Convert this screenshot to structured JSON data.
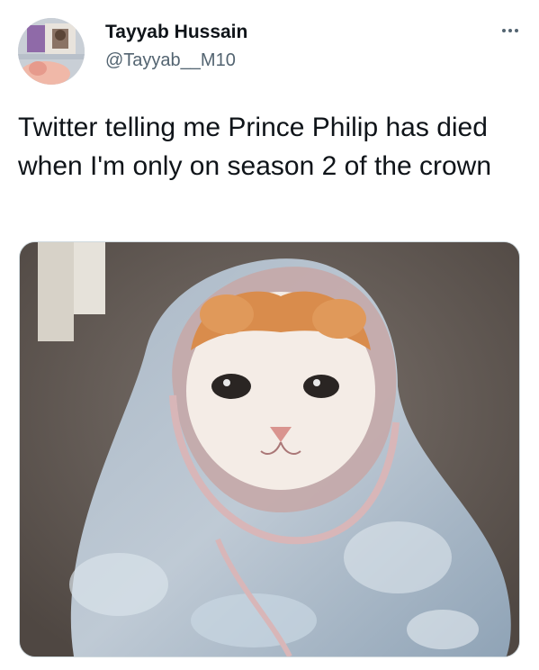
{
  "tweet": {
    "author_name": "Tayyab Hussain",
    "author_handle": "@Tayyab__M10",
    "text": "Twitter telling me Prince Philip has died when I'm only on season 2 of the crown",
    "more_icon": "more-horizontal-icon",
    "media": {
      "description_icon": "crying-cat-in-blanket-photo"
    }
  },
  "colors": {
    "text": "#0f1419",
    "secondary": "#536471",
    "border": "#cfd9de"
  }
}
